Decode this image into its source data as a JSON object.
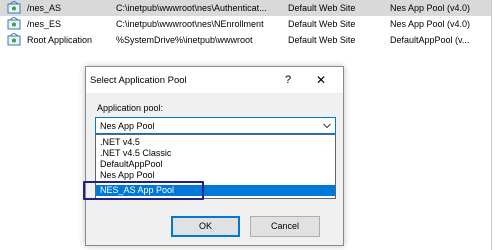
{
  "list": {
    "rows": [
      {
        "name": "/nes_AS",
        "path": "C:\\inetpub\\wwwroot\\nes\\Authenticat...",
        "site": "Default Web Site",
        "pool": "Nes App Pool (v4.0)",
        "selected": true
      },
      {
        "name": "/nes_ES",
        "path": "C:\\inetpub\\wwwroot\\nes\\NEnrollment",
        "site": "Default Web Site",
        "pool": "Nes App Pool (v4.0)",
        "selected": false
      },
      {
        "name": "Root Application",
        "path": "%SystemDrive%\\inetpub\\wwwroot",
        "site": "Default Web Site",
        "pool": "DefaultAppPool (v...",
        "selected": false
      }
    ],
    "row_icon": "application-icon"
  },
  "dialog": {
    "title": "Select Application Pool",
    "help_label": "?",
    "close_label": "✕",
    "pool_label": "Application pool:",
    "selected_pool": "Nes App Pool",
    "options": [
      ".NET v4.5",
      ".NET v4.5 Classic",
      "DefaultAppPool",
      "Nes App Pool",
      "NES_AS App Pool"
    ],
    "highlighted_option": "NES_AS App Pool",
    "ok_label": "OK",
    "cancel_label": "Cancel"
  },
  "colors": {
    "accent": "#0078d7",
    "annotation_box": "#1f1f8f",
    "row_selected": "#d9d9d9"
  }
}
